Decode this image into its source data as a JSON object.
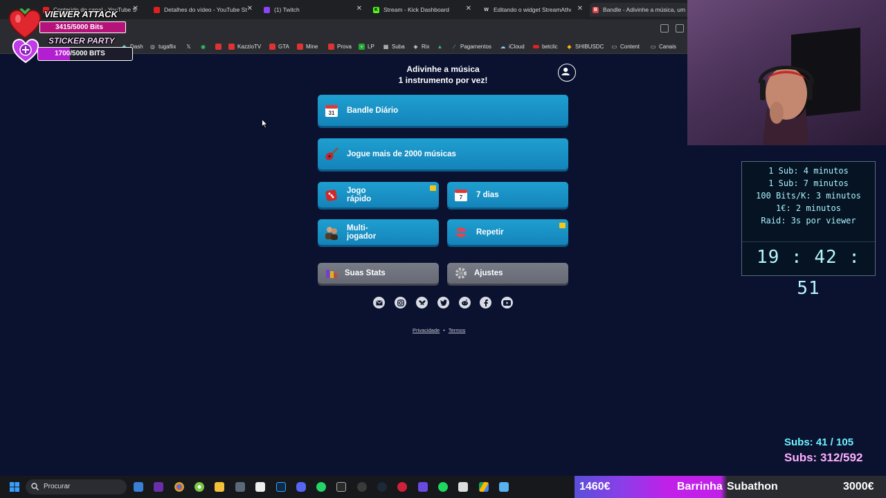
{
  "tabs": [
    {
      "title": "Conteúdo do canal - YouTube S",
      "color": "#e02020"
    },
    {
      "title": "Detalhes do vídeo - YouTube St",
      "color": "#e02020"
    },
    {
      "title": "(1) Twitch",
      "color": "#8a45f5"
    },
    {
      "title": "Stream - Kick Dashboard",
      "color": "#53fc18"
    },
    {
      "title": "Editando o widget StreamAthon",
      "color": "#dddddd"
    },
    {
      "title": "Bandle - Adivinhe a música, um",
      "color": "#d94040",
      "active": true
    }
  ],
  "bookmarks": [
    "Dash",
    "tugaflix",
    "",
    "",
    "",
    "KazzioTV",
    "GTA",
    "Mine",
    "Prova",
    "LP",
    "Suba",
    "Rix",
    "",
    "Pagamentos",
    "iCloud",
    "betclic",
    "SHIBUSDC",
    "Content",
    "Canais"
  ],
  "overlay": {
    "viewer_attack": "VIEWER ATTACK",
    "bits1": "3415/5000 Bits",
    "sticker_party": "STICKER PARTY",
    "bits2": "1700/5000 BITS"
  },
  "page": {
    "title_line1": "Adivinhe a música",
    "title_line2": "1 instrumento por vez!",
    "btn_daily": "Bandle Diário",
    "daily_icon_num": "31",
    "btn_more": "Jogue mais de 2000 músicas",
    "btn_quick_1": "Jogo",
    "btn_quick_2": "rápido",
    "btn_7days": "7 dias",
    "days_icon_num": "7",
    "btn_multi_1": "Multi-",
    "btn_multi_2": "jogador",
    "btn_repeat": "Repetir",
    "btn_stats": "Suas Stats",
    "btn_settings": "Ajustes",
    "footer_privacy": "Privacidade",
    "footer_dot": "•",
    "footer_terms": "Termos"
  },
  "subathon_info": {
    "rules": [
      "1 Sub: 4 minutos",
      "1 Sub: 7 minutos",
      "100 Bits/K: 3 minutos",
      "1€: 2 minutos",
      "Raid: 3s por viewer"
    ],
    "timer": "19 : 42 : 51",
    "subs_1": "Subs: 41 / 105",
    "subs_2": "Subs: 312/592"
  },
  "taskbar": {
    "search_placeholder": "Procurar"
  },
  "subathon_bar": {
    "left": "1460€",
    "label_a": "Barrinha",
    "label_b": "Subathon",
    "right": "3000€",
    "progress": 0.49
  },
  "colors": {
    "page_bg": "#0b1230",
    "button_blue": "#1a93c8",
    "button_grey": "#70737e",
    "timer_cyan": "#a9f3ff",
    "subs_pink": "#ffb1ff"
  }
}
